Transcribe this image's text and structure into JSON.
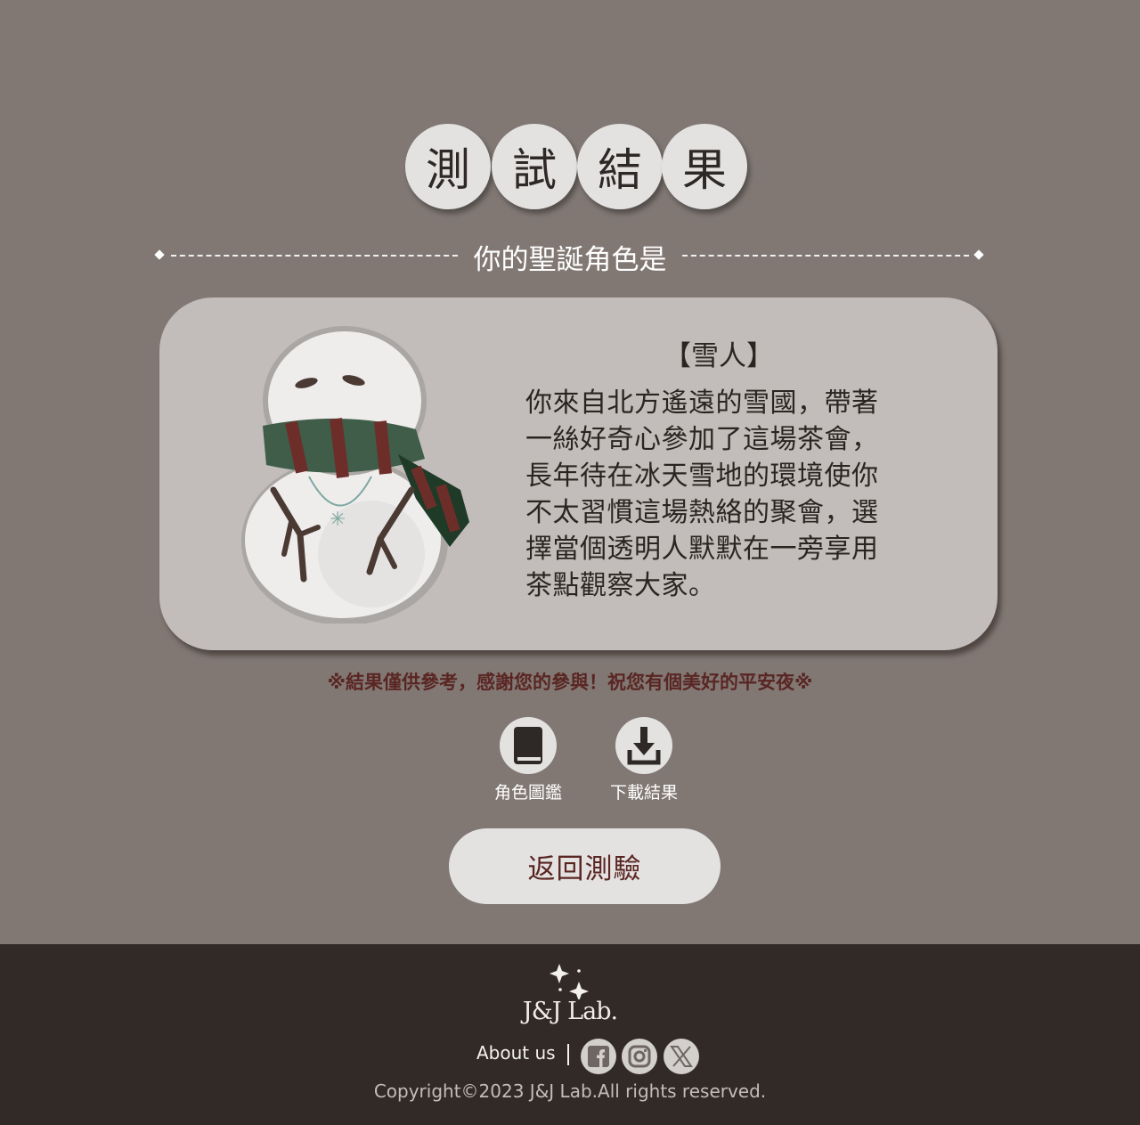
{
  "title": {
    "chars": [
      "測",
      "試",
      "結",
      "果"
    ]
  },
  "subtitle": "你的聖誕角色是",
  "result": {
    "name": "【雪人】",
    "description": "你來自北方遙遠的雪國，帶著一絲好奇心參加了這場茶會，長年待在冰天雪地的環境使你不太習慣這場熱絡的聚會，選擇當個透明人默默在一旁享用茶點觀察大家。",
    "image_icon": "snowman-illustration"
  },
  "notice": "※結果僅供參考，感謝您的參與！祝您有個美好的平安夜※",
  "actions": {
    "gallery_label": "角色圖鑑",
    "gallery_icon": "book-icon",
    "download_label": "下載結果",
    "download_icon": "download-icon",
    "back_label": "返回測驗"
  },
  "footer": {
    "logo_text": "J&J Lab.",
    "about_label": "About us",
    "social": [
      "facebook-icon",
      "instagram-icon",
      "x-icon"
    ],
    "copyright": "Copyright©2023 J&J Lab.All rights reserved."
  },
  "colors": {
    "background": "#817874",
    "card": "#c2bdba",
    "accent": "#5a2623",
    "footer": "#322a26"
  }
}
